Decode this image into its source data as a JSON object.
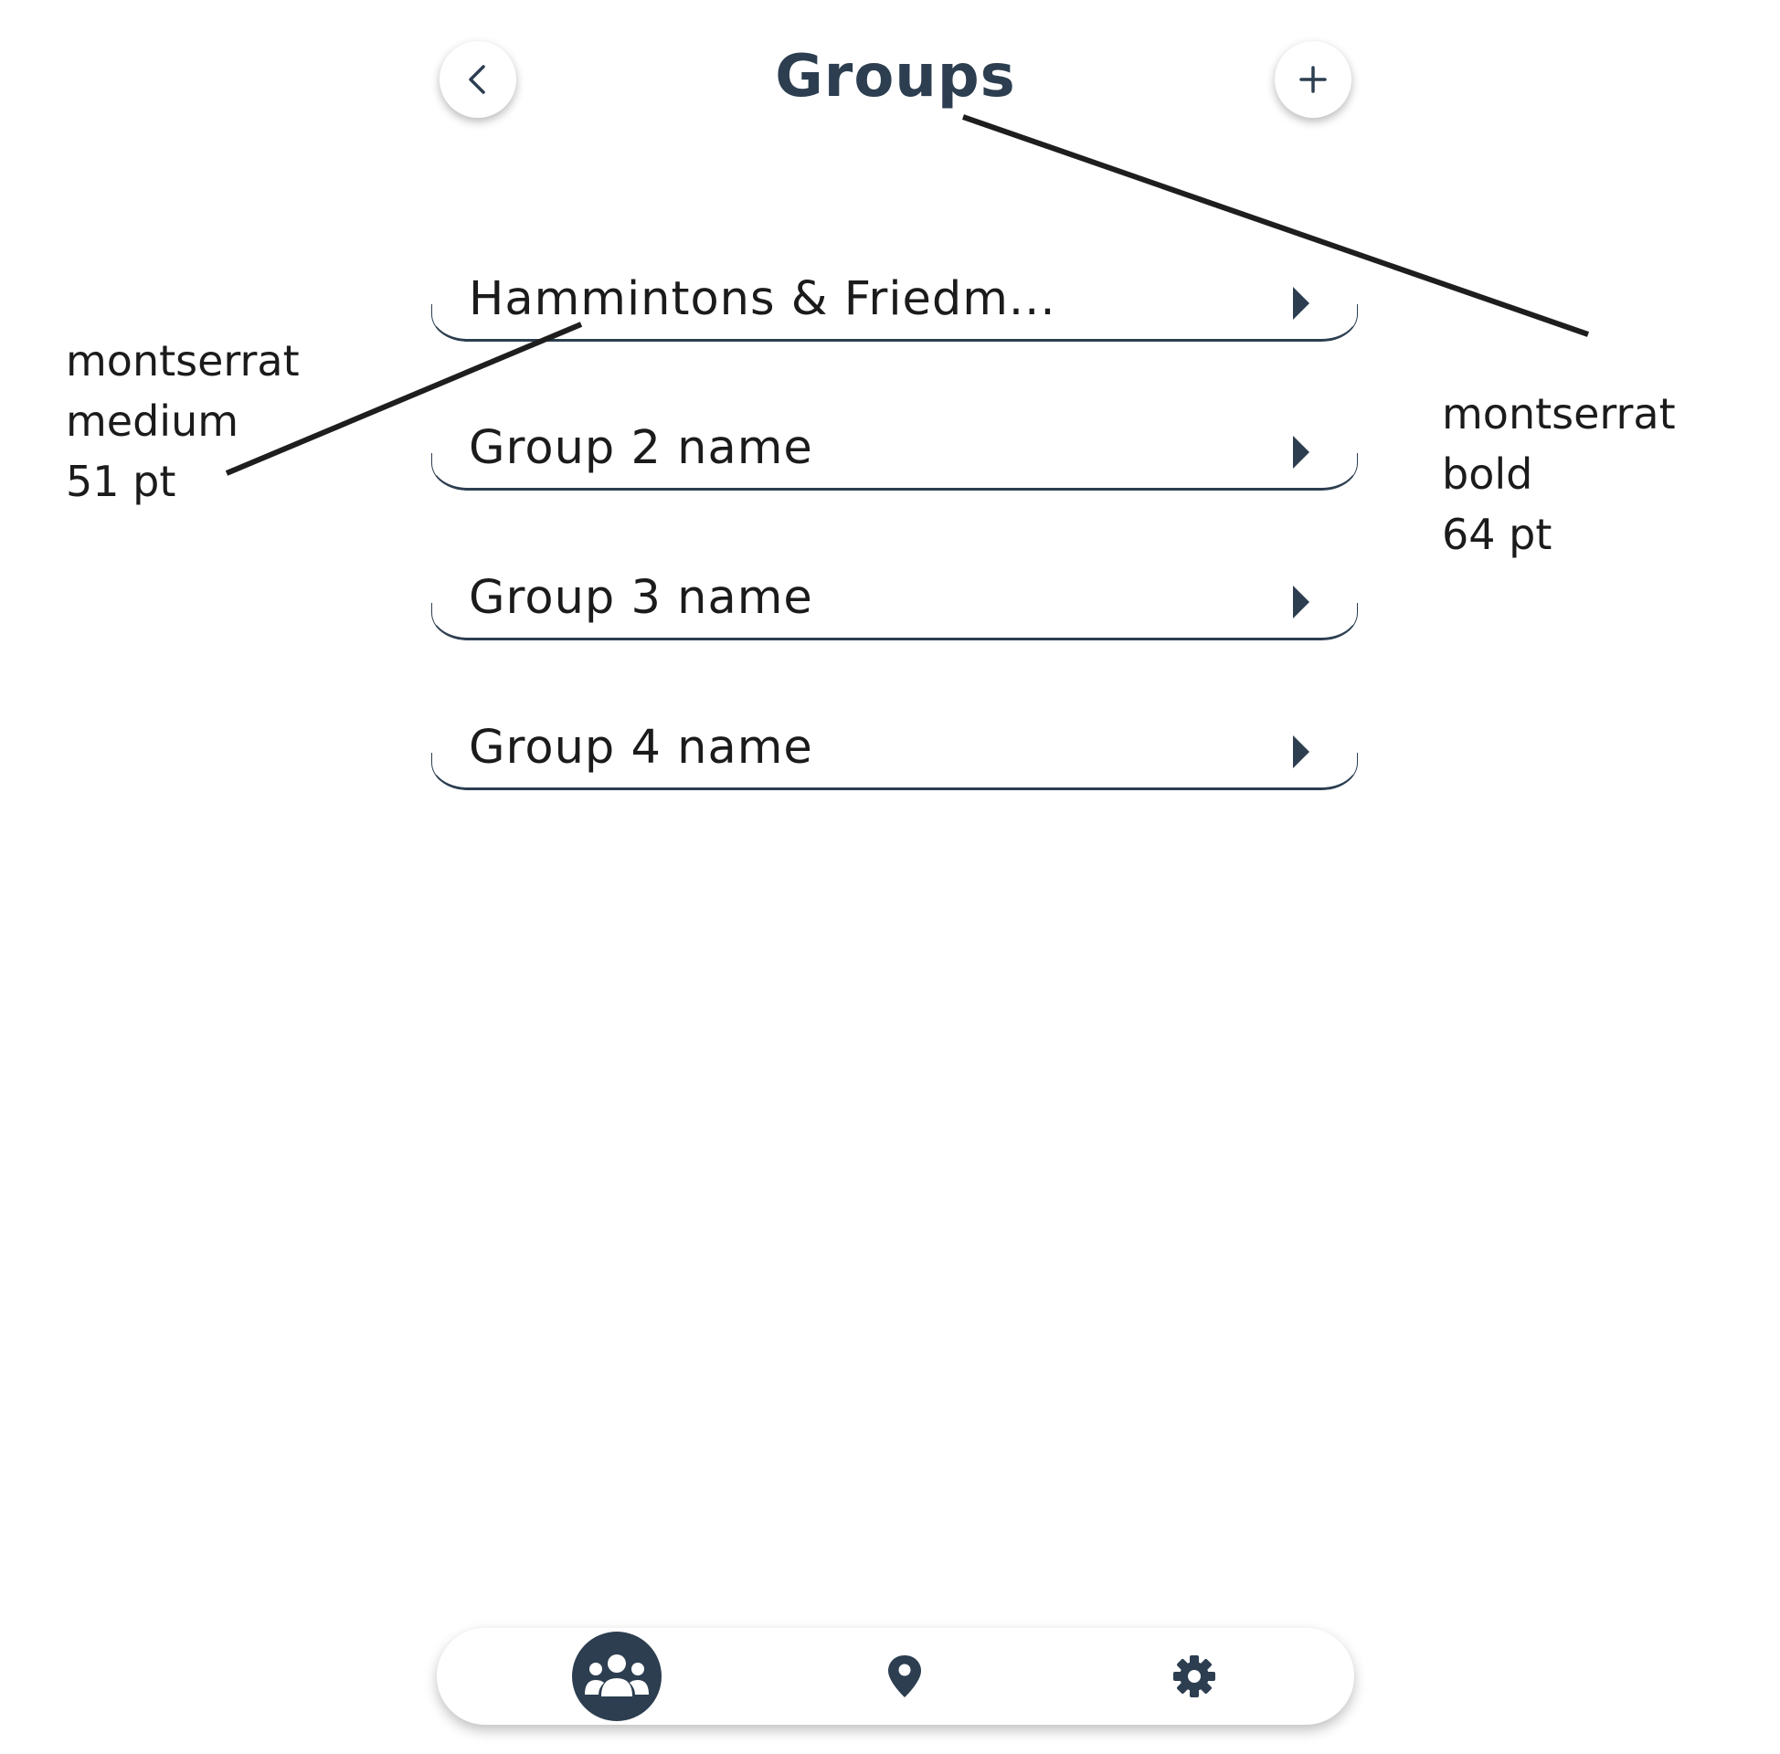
{
  "header": {
    "title": "Groups",
    "back_icon": "chevron-left-icon",
    "add_icon": "plus-icon"
  },
  "groups": [
    {
      "name": "Hammintons & Friedm..."
    },
    {
      "name": "Group 2 name"
    },
    {
      "name": "Group 3 name"
    },
    {
      "name": "Group 4 name"
    }
  ],
  "annotations": {
    "left": {
      "line1": "montserrat",
      "line2": "medium",
      "line3": "51 pt"
    },
    "right": {
      "line1": "montserrat",
      "line2": "bold",
      "line3": "64 pt"
    }
  },
  "bottom_nav": {
    "items": [
      {
        "icon": "users-icon",
        "active": true
      },
      {
        "icon": "map-pin-icon",
        "active": false
      },
      {
        "icon": "gear-icon",
        "active": false
      }
    ]
  },
  "colors": {
    "primary": "#2c3e50",
    "background": "#ffffff",
    "text": "#1b1b1b"
  }
}
